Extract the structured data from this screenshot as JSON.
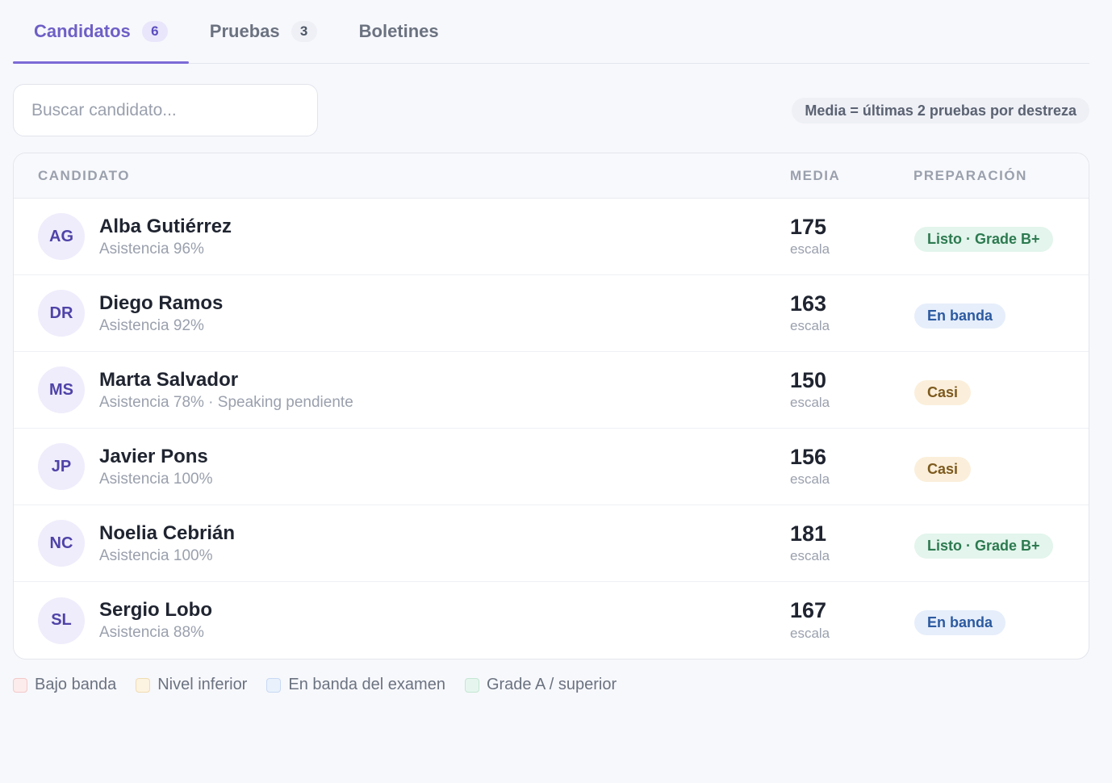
{
  "tabs": [
    {
      "label": "Candidatos",
      "count": "6",
      "active": true
    },
    {
      "label": "Pruebas",
      "count": "3",
      "active": false
    },
    {
      "label": "Boletines",
      "count": null,
      "active": false
    }
  ],
  "search": {
    "placeholder": "Buscar candidato..."
  },
  "note": "Media = últimas 2 pruebas por destreza",
  "table": {
    "headers": {
      "candidate": "CANDIDATO",
      "media": "MEDIA",
      "prep": "PREPARACIÓN"
    },
    "rows": [
      {
        "initials": "AG",
        "name": "Alba Gutiérrez",
        "sub": "Asistencia 96%",
        "score": "175",
        "unit": "escala",
        "status": "Listo · Grade B+",
        "status_kind": "green"
      },
      {
        "initials": "DR",
        "name": "Diego Ramos",
        "sub": "Asistencia 92%",
        "score": "163",
        "unit": "escala",
        "status": "En banda",
        "status_kind": "blue"
      },
      {
        "initials": "MS",
        "name": "Marta Salvador",
        "sub": "Asistencia 78% · Speaking pendiente",
        "score": "150",
        "unit": "escala",
        "status": "Casi",
        "status_kind": "amber"
      },
      {
        "initials": "JP",
        "name": "Javier Pons",
        "sub": "Asistencia 100%",
        "score": "156",
        "unit": "escala",
        "status": "Casi",
        "status_kind": "amber"
      },
      {
        "initials": "NC",
        "name": "Noelia Cebrián",
        "sub": "Asistencia 100%",
        "score": "181",
        "unit": "escala",
        "status": "Listo · Grade B+",
        "status_kind": "green"
      },
      {
        "initials": "SL",
        "name": "Sergio Lobo",
        "sub": "Asistencia 88%",
        "score": "167",
        "unit": "escala",
        "status": "En banda",
        "status_kind": "blue"
      }
    ]
  },
  "legend": [
    {
      "label": "Bajo banda",
      "fill": "#fdecec",
      "border": "#f3c9c9"
    },
    {
      "label": "Nivel inferior",
      "fill": "#fdf3e1",
      "border": "#f0dcb2"
    },
    {
      "label": "En banda del examen",
      "fill": "#e9f1fc",
      "border": "#c8d9f2"
    },
    {
      "label": "Grade A / superior",
      "fill": "#e6f6ee",
      "border": "#c4e6d3"
    }
  ]
}
